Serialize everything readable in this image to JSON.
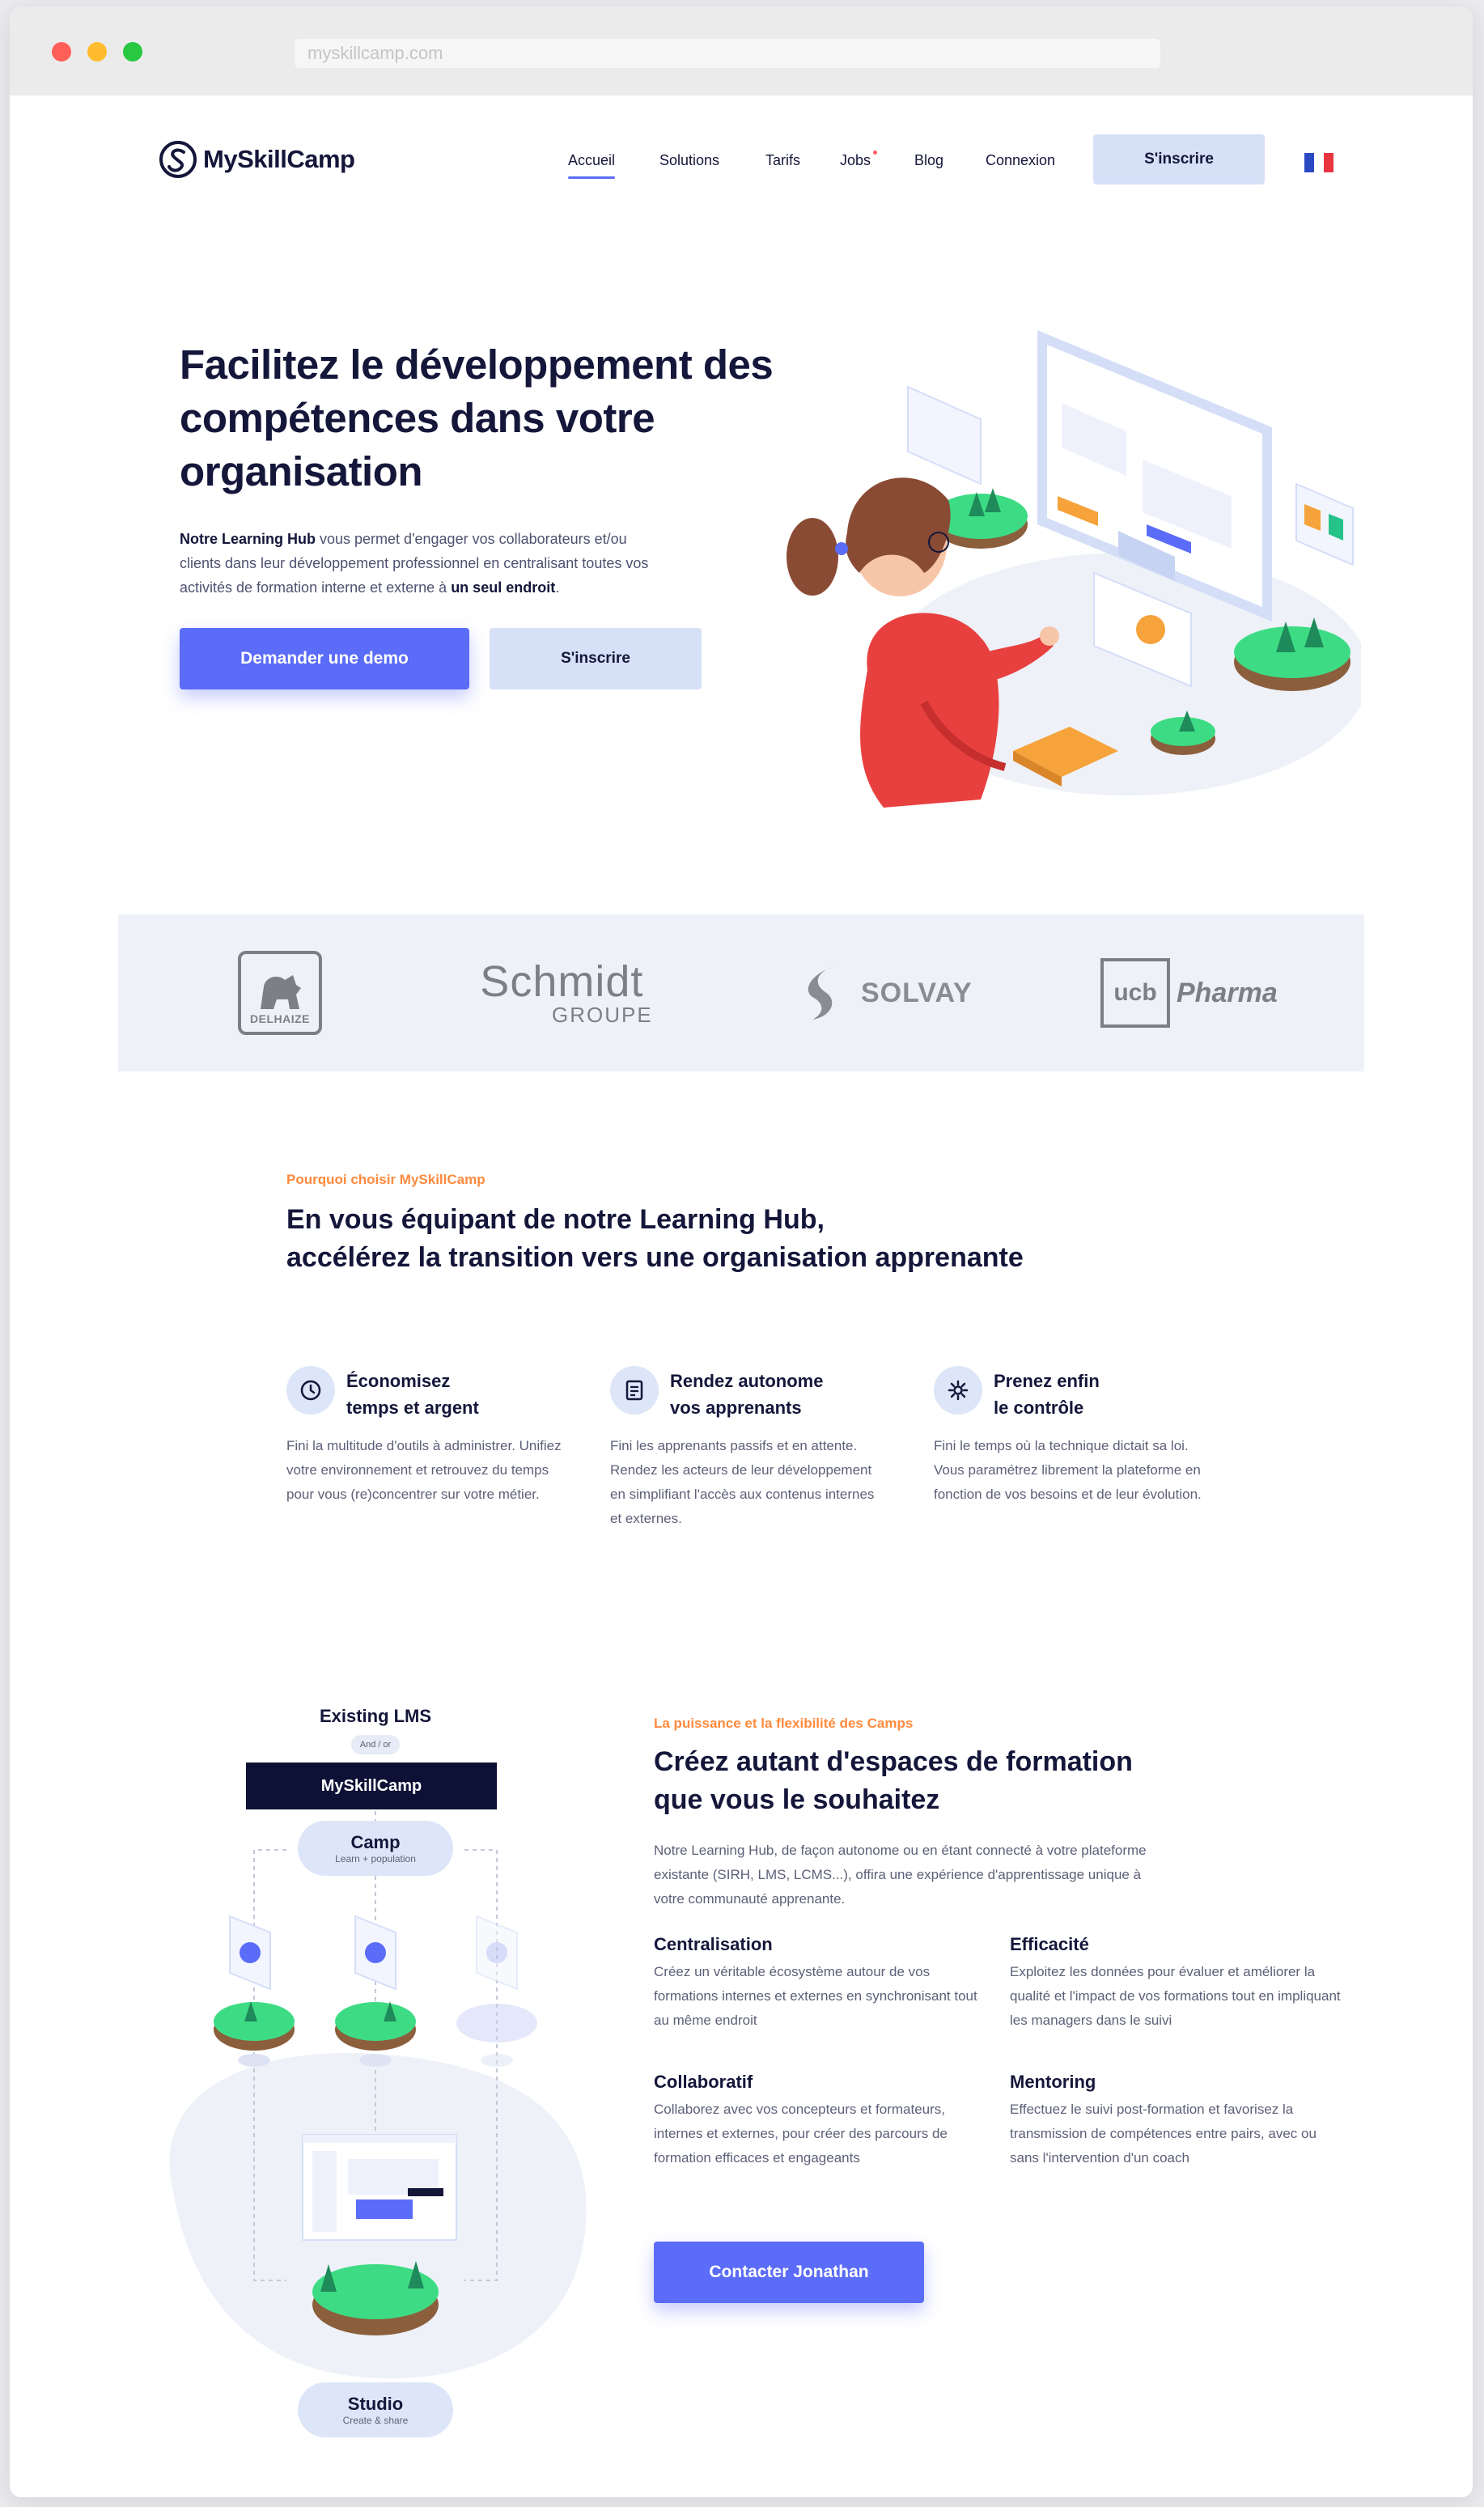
{
  "browser": {
    "address": "myskillcamp.com"
  },
  "nav": {
    "logo_text": "MySkillCamp",
    "items": [
      {
        "label": "Accueil",
        "active": true
      },
      {
        "label": "Solutions"
      },
      {
        "label": "Tarifs"
      },
      {
        "label": "Jobs",
        "badge": true
      },
      {
        "label": "Blog"
      },
      {
        "label": "Connexion"
      }
    ],
    "cta": "S'inscrire",
    "language_flag": "fr-flag-icon"
  },
  "hero": {
    "title": "Facilitez le développement des compétences dans votre organisation",
    "text_strong": "Notre Learning Hub",
    "text_mid": " vous permet d'engager vos collaborateurs et/ou clients dans leur développement professionnel en centralisant toutes vos activités de formation interne et externe à ",
    "text_strong2": "un seul endroit",
    "text_end": ".",
    "primary_button": "Demander une demo",
    "secondary_button": "S'inscrire"
  },
  "clients": {
    "delhaize": "DELHAIZE",
    "schmidt_main": "Schmidt",
    "schmidt_sub": "GROUPE",
    "solvay": "SOLVAY",
    "ucb_mark": "ucb",
    "ucb_text": "Pharma"
  },
  "why": {
    "eyebrow": "Pourquoi choisir MySkillCamp",
    "title_line1": "En vous équipant de notre Learning Hub,",
    "title_line2": "accélérez la transition vers une organisation apprenante",
    "features": [
      {
        "icon": "clock-icon",
        "title_line1": "Économisez",
        "title_line2": "temps et argent",
        "desc": "Fini la multitude d'outils à administrer. Unifiez votre environnement et retrouvez du temps pour vous (re)concentrer sur votre métier."
      },
      {
        "icon": "document-icon",
        "title_line1": "Rendez autonome",
        "title_line2": "vos apprenants",
        "desc": "Fini les apprenants passifs et en attente. Rendez les acteurs de leur développement en simplifiant l'accès aux contenus internes et externes."
      },
      {
        "icon": "gear-icon",
        "title_line1": "Prenez enfin",
        "title_line2": "le contrôle",
        "desc": "Fini le temps où la technique dictait sa loi. Vous paramétrez librement la plateforme en fonction de vos besoins et de leur évolution."
      }
    ]
  },
  "camps": {
    "diagram": {
      "existing_lms": "Existing LMS",
      "and_or": "And / or",
      "platform": "MySkillCamp",
      "camp": "Camp",
      "camp_sub": "Learn + population",
      "studio": "Studio",
      "studio_sub": "Create & share"
    },
    "eyebrow": "La puissance et la flexibilité des Camps",
    "title_line1": "Créez autant d'espaces de formation",
    "title_line2": "que vous le souhaitez",
    "text": "Notre Learning Hub, de façon autonome ou en étant connecté à votre plateforme existante (SIRH, LMS, LCMS...), offira une expérience d'apprentissage unique à votre communauté apprenante.",
    "items": [
      {
        "title": "Centralisation",
        "desc": "Créez un véritable écosystème autour de vos formations internes et externes en synchronisant tout au même endroit"
      },
      {
        "title": "Efficacité",
        "desc": "Exploitez les données pour évaluer et améliorer la qualité et l'impact de vos formations tout en impliquant les managers dans le suivi"
      },
      {
        "title": "Collaboratif",
        "desc": "Collaborez avec vos concepteurs et formateurs, internes et externes, pour créer des parcours de formation efficaces et engageants"
      },
      {
        "title": "Mentoring",
        "desc": "Effectuez le suivi post-formation et favorisez la transmission de compétences entre pairs, avec ou sans l'intervention d'un coach"
      }
    ],
    "cta": "Contacter Jonathan"
  },
  "colors": {
    "primary": "#5b6cf8",
    "secondary_button": "#d6e0f7",
    "navy": "#14163a",
    "accent_orange": "#ff8a3d",
    "logo_band": "#eef1f8"
  }
}
